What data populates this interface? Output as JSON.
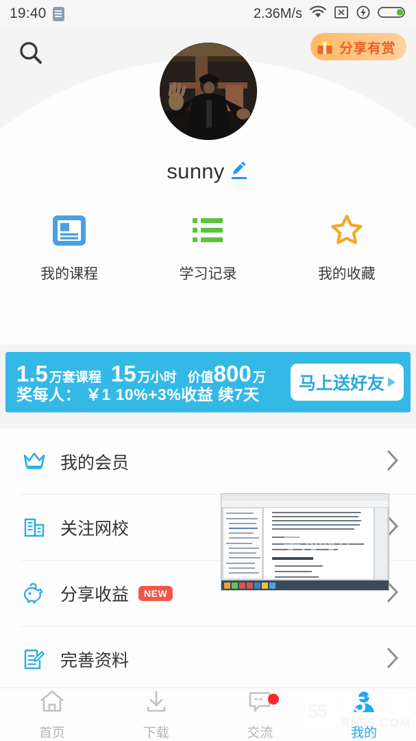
{
  "statusbar": {
    "time": "19:40",
    "network_speed": "2.36M/s",
    "icons": [
      "sim-card-icon",
      "wifi-icon",
      "no-signal-icon",
      "charging-bolt-icon",
      "battery-icon"
    ],
    "battery_color": "#5fbb2e"
  },
  "header": {
    "search_icon": "search-icon",
    "share_badge": {
      "label": "分享有赏",
      "icon": "gift-icon",
      "text_color": "#e8622a"
    },
    "avatar_alt": "用户头像",
    "username": "sunny",
    "edit_icon": "pencil-edit-icon",
    "edit_icon_color": "#2196f3"
  },
  "quick_actions": [
    {
      "label": "我的课程",
      "icon": "course-card-icon",
      "color": "#4a9fe8"
    },
    {
      "label": "学习记录",
      "icon": "list-lines-icon",
      "color": "#5cc439"
    },
    {
      "label": "我的收藏",
      "icon": "star-outline-icon",
      "color": "#f5a623"
    }
  ],
  "banner": {
    "background": "#34b9e6",
    "line1": [
      {
        "big": "1.5",
        "small": "万套课程"
      },
      {
        "big": "15",
        "small": "万小时"
      },
      {
        "pre": "价值",
        "big": "800",
        "small": "万"
      }
    ],
    "line2": "奖每人： ￥1  10%+3%收益  续7天",
    "button": {
      "label": "马上送好友",
      "icon": "play-triangle-icon",
      "color": "#2ba8dc"
    }
  },
  "menu": [
    {
      "label": "我的会员",
      "icon": "crown-icon",
      "badge": "",
      "chevron": "chevron-right-icon"
    },
    {
      "label": "关注网校",
      "icon": "building-icon",
      "badge": "",
      "chevron": "chevron-right-icon"
    },
    {
      "label": "分享收益",
      "icon": "piggy-bank-icon",
      "badge": "NEW",
      "chevron": "chevron-right-icon"
    },
    {
      "label": "完善资料",
      "icon": "edit-document-icon",
      "badge": "",
      "chevron": "chevron-right-icon"
    }
  ],
  "overlay_thumb": {
    "name": "floating-video-thumbnail",
    "description": "Windows桌面Word文档截图",
    "watermark": "学为时代",
    "close_icon": "close-x-icon"
  },
  "bottom_nav": [
    {
      "label": "首页",
      "icon": "home-icon",
      "active": false,
      "dot": false
    },
    {
      "label": "下载",
      "icon": "download-icon",
      "active": false,
      "dot": false
    },
    {
      "label": "交流",
      "icon": "chat-bubble-icon",
      "active": false,
      "dot": true
    },
    {
      "label": "我的",
      "icon": "person-icon",
      "active": true,
      "dot": false
    }
  ],
  "nav_active_color": "#23a8f2",
  "watermark": {
    "logo": "55",
    "main": "55下载",
    "sub": "RP55.COM"
  }
}
